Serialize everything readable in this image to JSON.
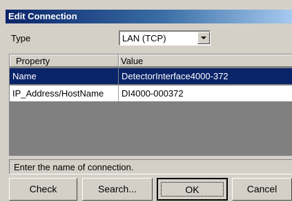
{
  "window": {
    "title": "Edit Connection"
  },
  "type_field": {
    "label": "Type",
    "selected": "LAN (TCP)"
  },
  "grid": {
    "headers": {
      "property": "Property",
      "value": "Value"
    },
    "rows": [
      {
        "property": "Name",
        "value": "DetectorInterface4000-372",
        "selected": true
      },
      {
        "property": "IP_Address/HostName",
        "value": "DI4000-000372",
        "selected": false
      }
    ]
  },
  "status_text": "Enter the name of connection.",
  "buttons": {
    "check": "Check",
    "search": "Search...",
    "ok": "OK",
    "cancel": "Cancel"
  },
  "colors": {
    "title_gradient_start": "#0a246a",
    "selection": "#0a246a",
    "dialog_bg": "#d4d0c8",
    "grid_bg": "#808080"
  }
}
